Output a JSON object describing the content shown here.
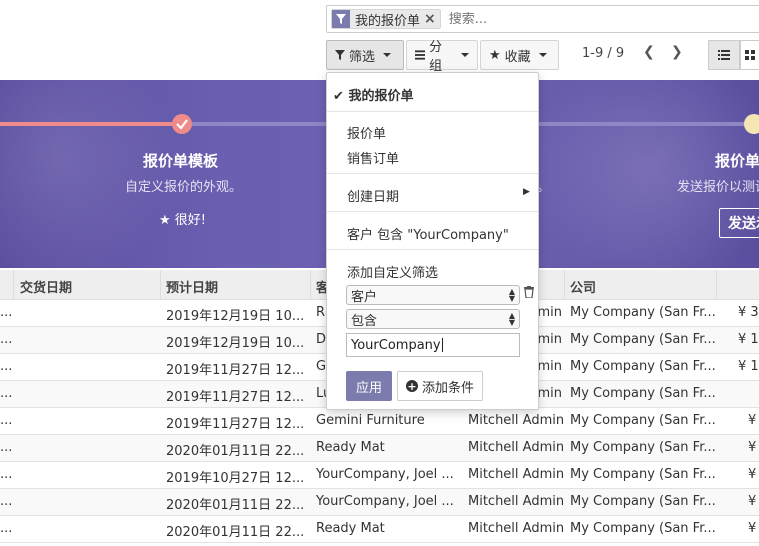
{
  "search": {
    "facet_label": "我的报价单",
    "placeholder": "搜索..."
  },
  "controls": {
    "filter_label": "筛选",
    "groupby_label": "分组",
    "favorites_label": "收藏",
    "pager": "1-9 / 9"
  },
  "banner": {
    "step1_title": "报价单模板",
    "step1_sub": "自定义报价的外观。",
    "step1_link": "很好!",
    "step2_sub_fragment": "。",
    "step3_title": "报价单",
    "step3_sub": "发送报价以测试",
    "step3_button": "发送示"
  },
  "table": {
    "headers": [
      "交货日期",
      "预计日期",
      "客",
      "公司"
    ],
    "rows": [
      {
        "date": "2019年12月19日 10...",
        "customer": "R",
        "salesperson": "dmin",
        "company": "My Company (San Fr...",
        "amount": "¥ 3"
      },
      {
        "date": "2019年12月19日 10...",
        "customer": "D",
        "salesperson": "dmin",
        "company": "My Company (San Fr...",
        "amount": "¥ 1"
      },
      {
        "date": "2019年11月27日 12...",
        "customer": "G",
        "salesperson": "dmin",
        "company": "My Company (San Fr...",
        "amount": "¥ 1"
      },
      {
        "date": "2019年11月27日 12...",
        "customer": "Lu",
        "salesperson": "dmin",
        "company": "My Company (San Fr...",
        "amount": ""
      },
      {
        "date": "2019年11月27日 12...",
        "customer": "Gemini Furniture",
        "salesperson": "Mitchell Admin",
        "company": "My Company (San Fr...",
        "amount": "¥"
      },
      {
        "date": "2020年01月11日 22...",
        "customer": "Ready Mat",
        "salesperson": "Mitchell Admin",
        "company": "My Company (San Fr...",
        "amount": "¥"
      },
      {
        "date": "2019年10月27日 12...",
        "customer": "YourCompany, Joel ...",
        "salesperson": "Mitchell Admin",
        "company": "My Company (San Fr...",
        "amount": "¥"
      },
      {
        "date": "2020年01月11日 22...",
        "customer": "YourCompany, Joel ...",
        "salesperson": "Mitchell Admin",
        "company": "My Company (San Fr...",
        "amount": "¥"
      },
      {
        "date": "2020年01月11日 22...",
        "customer": "Ready Mat",
        "salesperson": "Mitchell Admin",
        "company": "My Company (San Fr...",
        "amount": "¥"
      }
    ]
  },
  "dropdown": {
    "my_quotations": "我的报价单",
    "quotations": "报价单",
    "sales_orders": "销售订单",
    "creation_date": "创建日期",
    "custom_filter_desc": "客户 包含 \"YourCompany\"",
    "add_custom_filter": "添加自定义筛选",
    "field_select": "客户",
    "operator_select": "包含",
    "value_input": "YourCompany",
    "apply": "应用",
    "add_condition": "添加条件"
  },
  "colors": {
    "primary": "#7c7bad",
    "banner": "#6a5fb0"
  }
}
